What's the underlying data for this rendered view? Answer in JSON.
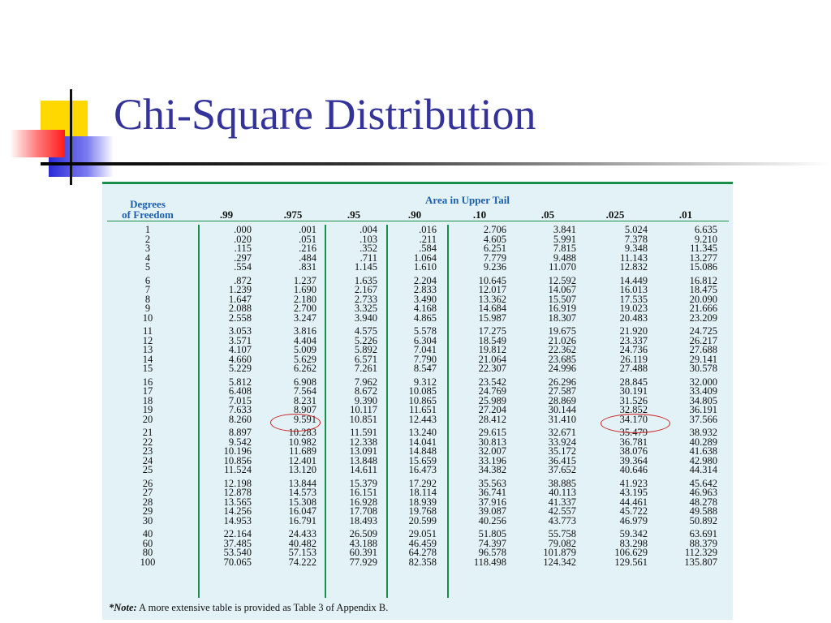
{
  "title": "Chi-Square Distribution",
  "table": {
    "df_header_line1": "Degrees",
    "df_header_line2": "of Freedom",
    "area_header": "Area in Upper Tail",
    "columns": [
      ".99",
      ".975",
      ".95",
      ".90",
      ".10",
      ".05",
      ".025",
      ".01"
    ],
    "rows": [
      {
        "df": "1",
        "v": [
          ".000",
          ".001",
          ".004",
          ".016",
          "2.706",
          "3.841",
          "5.024",
          "6.635"
        ]
      },
      {
        "df": "2",
        "v": [
          ".020",
          ".051",
          ".103",
          ".211",
          "4.605",
          "5.991",
          "7.378",
          "9.210"
        ]
      },
      {
        "df": "3",
        "v": [
          ".115",
          ".216",
          ".352",
          ".584",
          "6.251",
          "7.815",
          "9.348",
          "11.345"
        ]
      },
      {
        "df": "4",
        "v": [
          ".297",
          ".484",
          ".711",
          "1.064",
          "7.779",
          "9.488",
          "11.143",
          "13.277"
        ]
      },
      {
        "df": "5",
        "v": [
          ".554",
          ".831",
          "1.145",
          "1.610",
          "9.236",
          "11.070",
          "12.832",
          "15.086"
        ]
      },
      {
        "df": "6",
        "v": [
          ".872",
          "1.237",
          "1.635",
          "2.204",
          "10.645",
          "12.592",
          "14.449",
          "16.812"
        ]
      },
      {
        "df": "7",
        "v": [
          "1.239",
          "1.690",
          "2.167",
          "2.833",
          "12.017",
          "14.067",
          "16.013",
          "18.475"
        ]
      },
      {
        "df": "8",
        "v": [
          "1.647",
          "2.180",
          "2.733",
          "3.490",
          "13.362",
          "15.507",
          "17.535",
          "20.090"
        ]
      },
      {
        "df": "9",
        "v": [
          "2.088",
          "2.700",
          "3.325",
          "4.168",
          "14.684",
          "16.919",
          "19.023",
          "21.666"
        ]
      },
      {
        "df": "10",
        "v": [
          "2.558",
          "3.247",
          "3.940",
          "4.865",
          "15.987",
          "18.307",
          "20.483",
          "23.209"
        ]
      },
      {
        "df": "11",
        "v": [
          "3.053",
          "3.816",
          "4.575",
          "5.578",
          "17.275",
          "19.675",
          "21.920",
          "24.725"
        ]
      },
      {
        "df": "12",
        "v": [
          "3.571",
          "4.404",
          "5.226",
          "6.304",
          "18.549",
          "21.026",
          "23.337",
          "26.217"
        ]
      },
      {
        "df": "13",
        "v": [
          "4.107",
          "5.009",
          "5.892",
          "7.041",
          "19.812",
          "22.362",
          "24.736",
          "27.688"
        ]
      },
      {
        "df": "14",
        "v": [
          "4.660",
          "5.629",
          "6.571",
          "7.790",
          "21.064",
          "23.685",
          "26.119",
          "29.141"
        ]
      },
      {
        "df": "15",
        "v": [
          "5.229",
          "6.262",
          "7.261",
          "8.547",
          "22.307",
          "24.996",
          "27.488",
          "30.578"
        ]
      },
      {
        "df": "16",
        "v": [
          "5.812",
          "6.908",
          "7.962",
          "9.312",
          "23.542",
          "26.296",
          "28.845",
          "32.000"
        ]
      },
      {
        "df": "17",
        "v": [
          "6.408",
          "7.564",
          "8.672",
          "10.085",
          "24.769",
          "27.587",
          "30.191",
          "33.409"
        ]
      },
      {
        "df": "18",
        "v": [
          "7.015",
          "8.231",
          "9.390",
          "10.865",
          "25.989",
          "28.869",
          "31.526",
          "34.805"
        ]
      },
      {
        "df": "19",
        "v": [
          "7.633",
          "8.907",
          "10.117",
          "11.651",
          "27.204",
          "30.144",
          "32.852",
          "36.191"
        ]
      },
      {
        "df": "20",
        "v": [
          "8.260",
          "9.591",
          "10.851",
          "12.443",
          "28.412",
          "31.410",
          "34.170",
          "37.566"
        ]
      },
      {
        "df": "21",
        "v": [
          "8.897",
          "10.283",
          "11.591",
          "13.240",
          "29.615",
          "32.671",
          "35.479",
          "38.932"
        ]
      },
      {
        "df": "22",
        "v": [
          "9.542",
          "10.982",
          "12.338",
          "14.041",
          "30.813",
          "33.924",
          "36.781",
          "40.289"
        ]
      },
      {
        "df": "23",
        "v": [
          "10.196",
          "11.689",
          "13.091",
          "14.848",
          "32.007",
          "35.172",
          "38.076",
          "41.638"
        ]
      },
      {
        "df": "24",
        "v": [
          "10.856",
          "12.401",
          "13.848",
          "15.659",
          "33.196",
          "36.415",
          "39.364",
          "42.980"
        ]
      },
      {
        "df": "25",
        "v": [
          "11.524",
          "13.120",
          "14.611",
          "16.473",
          "34.382",
          "37.652",
          "40.646",
          "44.314"
        ]
      },
      {
        "df": "26",
        "v": [
          "12.198",
          "13.844",
          "15.379",
          "17.292",
          "35.563",
          "38.885",
          "41.923",
          "45.642"
        ]
      },
      {
        "df": "27",
        "v": [
          "12.878",
          "14.573",
          "16.151",
          "18.114",
          "36.741",
          "40.113",
          "43.195",
          "46.963"
        ]
      },
      {
        "df": "28",
        "v": [
          "13.565",
          "15.308",
          "16.928",
          "18.939",
          "37.916",
          "41.337",
          "44.461",
          "48.278"
        ]
      },
      {
        "df": "29",
        "v": [
          "14.256",
          "16.047",
          "17.708",
          "19.768",
          "39.087",
          "42.557",
          "45.722",
          "49.588"
        ]
      },
      {
        "df": "30",
        "v": [
          "14.953",
          "16.791",
          "18.493",
          "20.599",
          "40.256",
          "43.773",
          "46.979",
          "50.892"
        ]
      },
      {
        "df": "40",
        "v": [
          "22.164",
          "24.433",
          "26.509",
          "29.051",
          "51.805",
          "55.758",
          "59.342",
          "63.691"
        ]
      },
      {
        "df": "60",
        "v": [
          "37.485",
          "40.482",
          "43.188",
          "46.459",
          "74.397",
          "79.082",
          "83.298",
          "88.379"
        ]
      },
      {
        "df": "80",
        "v": [
          "53.540",
          "57.153",
          "60.391",
          "64.278",
          "96.578",
          "101.879",
          "106.629",
          "112.329"
        ]
      },
      {
        "df": "100",
        "v": [
          "70.065",
          "74.222",
          "77.929",
          "82.358",
          "118.498",
          "124.342",
          "129.561",
          "135.807"
        ]
      }
    ],
    "note_label": "*Note:",
    "note_text": " A more extensive table is provided as Table 3 of Appendix B."
  },
  "colors": {
    "title": "#333399",
    "header": "#1b5fae",
    "rule": "#1a8f4a",
    "panel": "#e3f2f6",
    "highlight": "#cc1f1f"
  }
}
